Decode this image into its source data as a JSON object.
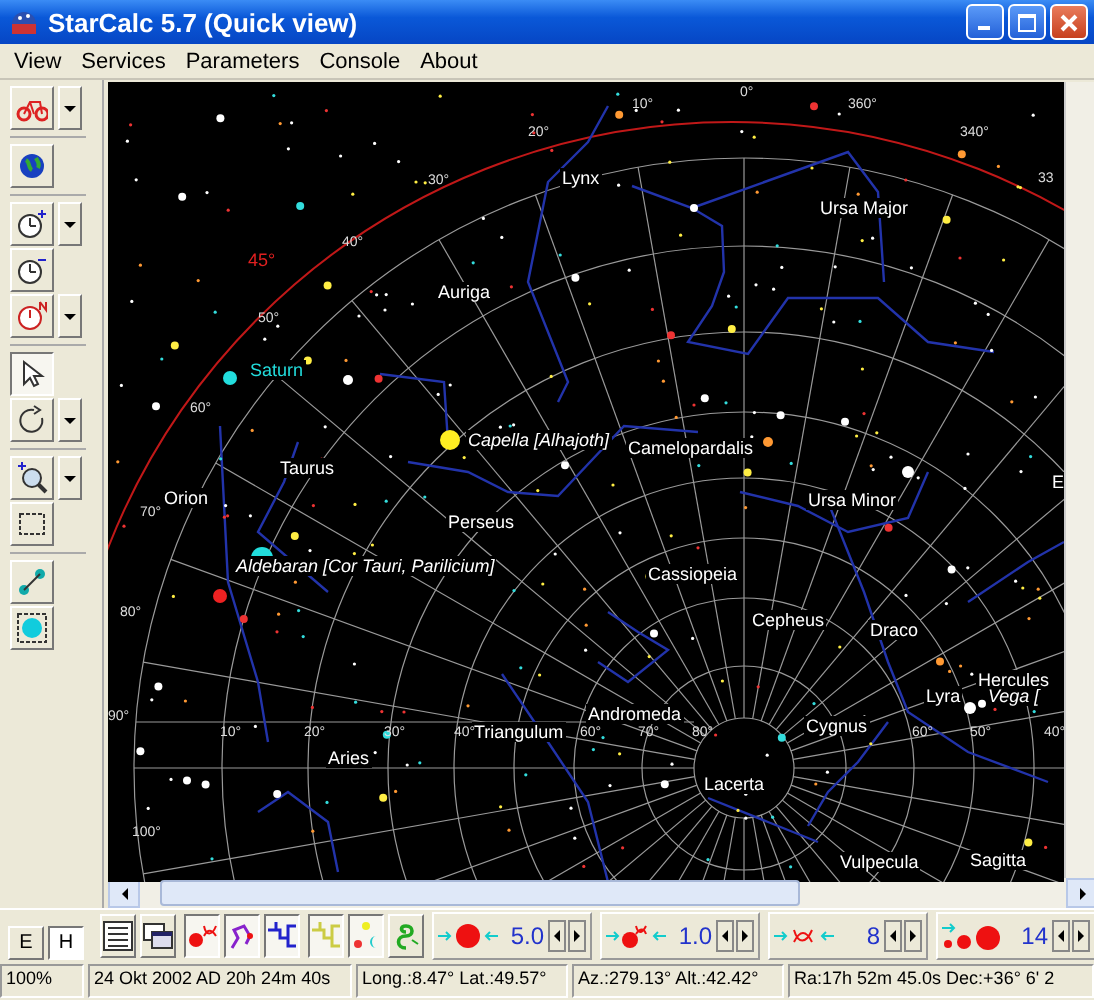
{
  "window": {
    "title": "StarCalc 5.7 (Quick view)"
  },
  "menu": [
    {
      "label": "View"
    },
    {
      "label": "Services"
    },
    {
      "label": "Parameters"
    },
    {
      "label": "Console"
    },
    {
      "label": "About"
    }
  ],
  "left_toolbar": [
    {
      "kind": "bicycle",
      "pressed": false,
      "dropdown": true
    },
    {
      "kind": "globe",
      "pressed": false,
      "dropdown": false
    },
    {
      "kind": "clock-plus",
      "pressed": false,
      "dropdown": true
    },
    {
      "kind": "clock-minus",
      "pressed": false,
      "dropdown": false
    },
    {
      "kind": "clock-reset",
      "pressed": false,
      "dropdown": true
    },
    {
      "kind": "pointer",
      "pressed": true,
      "dropdown": false
    },
    {
      "kind": "rotate",
      "pressed": false,
      "dropdown": true
    },
    {
      "kind": "zoom",
      "pressed": false,
      "dropdown": true
    },
    {
      "kind": "select-rect",
      "pressed": false,
      "dropdown": false
    },
    {
      "kind": "connect",
      "pressed": false,
      "dropdown": false
    },
    {
      "kind": "select-circle",
      "pressed": false,
      "dropdown": false
    }
  ],
  "chart": {
    "labels": [
      {
        "text": "Lynx",
        "kind": "constellation"
      },
      {
        "text": "Ursa Major",
        "kind": "constellation"
      },
      {
        "text": "Auriga",
        "kind": "constellation"
      },
      {
        "text": "Saturn",
        "kind": "planet"
      },
      {
        "text": "Capella [Alhajoth]",
        "kind": "star"
      },
      {
        "text": "Camelopardalis",
        "kind": "constellation"
      },
      {
        "text": "Taurus",
        "kind": "constellation"
      },
      {
        "text": "Orion",
        "kind": "constellation"
      },
      {
        "text": "Perseus",
        "kind": "constellation"
      },
      {
        "text": "Ursa Minor",
        "kind": "constellation"
      },
      {
        "text": "Aldebaran [Cor Tauri, Parilicium]",
        "kind": "star"
      },
      {
        "text": "Cassiopeia",
        "kind": "constellation"
      },
      {
        "text": "Cepheus",
        "kind": "constellation"
      },
      {
        "text": "Draco",
        "kind": "constellation"
      },
      {
        "text": "Hercules",
        "kind": "constellation"
      },
      {
        "text": "Lyra",
        "kind": "constellation"
      },
      {
        "text": "Vega [",
        "kind": "star"
      },
      {
        "text": "Andromeda",
        "kind": "constellation"
      },
      {
        "text": "Cygnus",
        "kind": "constellation"
      },
      {
        "text": "Triangulum",
        "kind": "constellation"
      },
      {
        "text": "Aries",
        "kind": "constellation"
      },
      {
        "text": "Lacerta",
        "kind": "constellation"
      },
      {
        "text": "Vulpecula",
        "kind": "constellation"
      },
      {
        "text": "Sagitta",
        "kind": "constellation"
      },
      {
        "text": "E",
        "kind": "constellation"
      }
    ],
    "degree_labels": [
      {
        "text": "0°",
        "kind": "grid"
      },
      {
        "text": "10°",
        "kind": "grid"
      },
      {
        "text": "20°",
        "kind": "grid"
      },
      {
        "text": "30°",
        "kind": "grid"
      },
      {
        "text": "40°",
        "kind": "grid"
      },
      {
        "text": "50°",
        "kind": "grid"
      },
      {
        "text": "60°",
        "kind": "grid"
      },
      {
        "text": "360°",
        "kind": "grid"
      },
      {
        "text": "340°",
        "kind": "grid"
      },
      {
        "text": "33",
        "kind": "grid"
      },
      {
        "text": "45°",
        "kind": "horizon"
      },
      {
        "text": "70°",
        "kind": "grid"
      },
      {
        "text": "80°",
        "kind": "grid"
      },
      {
        "text": "90°",
        "kind": "grid"
      },
      {
        "text": "100°",
        "kind": "grid"
      },
      {
        "text": "10°",
        "kind": "grid"
      },
      {
        "text": "20°",
        "kind": "grid"
      },
      {
        "text": "30°",
        "kind": "grid"
      },
      {
        "text": "40°",
        "kind": "grid"
      },
      {
        "text": "60°",
        "kind": "grid"
      },
      {
        "text": "70°",
        "kind": "grid"
      },
      {
        "text": "80°",
        "kind": "grid"
      },
      {
        "text": "60°",
        "kind": "grid"
      },
      {
        "text": "50°",
        "kind": "grid"
      },
      {
        "text": "40°",
        "kind": "grid"
      }
    ]
  },
  "view_buttons": [
    {
      "label": "E",
      "selected": false
    },
    {
      "label": "H",
      "selected": true
    }
  ],
  "bottom_toolbar": [
    {
      "kind": "table",
      "pressed": false
    },
    {
      "kind": "windows",
      "pressed": false
    },
    {
      "kind": "star-names",
      "pressed": true
    },
    {
      "kind": "constellation-lines",
      "pressed": true
    },
    {
      "kind": "boundaries",
      "pressed": true
    },
    {
      "kind": "boundaries-alt",
      "pressed": true
    },
    {
      "kind": "planets",
      "pressed": true
    },
    {
      "kind": "spiral",
      "pressed": false
    }
  ],
  "spinners": [
    {
      "kind": "star-size",
      "value": "5.0"
    },
    {
      "kind": "label-size",
      "value": "1.0"
    },
    {
      "kind": "label-count",
      "value": "8"
    },
    {
      "kind": "magnitude",
      "value": "14"
    }
  ],
  "status_bar": [
    {
      "text": "100%"
    },
    {
      "text": "24 Okt 2002 AD 20h 24m 40s"
    },
    {
      "text": "Long.:8.47° Lat.:49.57°"
    },
    {
      "text": "Az.:279.13° Alt.:42.42°"
    },
    {
      "text": "Ra:17h 52m 45.0s Dec:+36° 6' 2"
    }
  ]
}
